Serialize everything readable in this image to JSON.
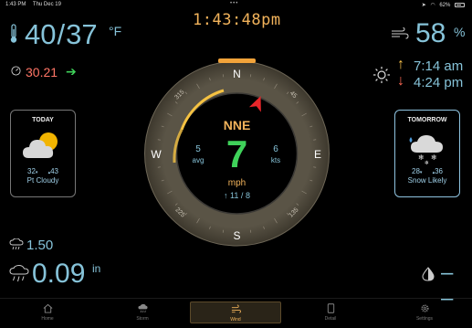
{
  "status_bar": {
    "time": "1:43 PM",
    "date": "Thu Dec 19",
    "dots": "•••",
    "battery": "62%"
  },
  "clock": "1:43:48pm",
  "outdoor": {
    "temp_high": "40",
    "separator": "/",
    "temp_low": "37",
    "temp_unit": "°F",
    "pressure": "30.21",
    "pressure_trend": "➔",
    "humidity": "58",
    "humidity_unit": "%"
  },
  "sun": {
    "sunrise_arrow": "↑",
    "sunrise": "7:14 am",
    "sunset_arrow": "↓",
    "sunset": "4:24 pm"
  },
  "today": {
    "title": "TODAY",
    "low": "32",
    "high": "43",
    "low_marker": "▾",
    "high_marker": "▴",
    "desc": "Pt Cloudy",
    "icon": "partly-cloudy-icon"
  },
  "tomorrow": {
    "title": "TOMORROW",
    "low": "28",
    "high": "36",
    "low_marker": "▾",
    "high_marker": "▴",
    "desc": "Snow Likely",
    "icon": "snow-icon"
  },
  "rain": {
    "rate": "1.50",
    "total": "0.09",
    "unit": "in"
  },
  "dew": "– –",
  "wind": {
    "direction": "NNE",
    "speed": "7",
    "unit": "mph",
    "avg": "5",
    "avg_label": "avg",
    "gust": "6",
    "gust_label": "kts",
    "gust_arrow": "↑",
    "peak": "11",
    "peak_sep": "/",
    "peak2": "8",
    "heading_deg": 22.5,
    "cardinals": {
      "n": "N",
      "e": "E",
      "s": "S",
      "w": "W"
    },
    "degree_labels": [
      "45",
      "135",
      "225",
      "315"
    ]
  },
  "tabs": [
    {
      "label": "Home",
      "icon": "home-icon"
    },
    {
      "label": "Storm",
      "icon": "storm-icon"
    },
    {
      "label": "Wind",
      "icon": "wind-icon",
      "active": true
    },
    {
      "label": "Detail",
      "icon": "detail-icon"
    },
    {
      "label": "Settings",
      "icon": "gear-icon"
    }
  ],
  "colors": {
    "accent": "#f2b35b",
    "value_blue": "#86c3d9",
    "speed_green": "#3fd25a",
    "pressure_red": "#ff7566",
    "heading_red": "#e8262a"
  }
}
